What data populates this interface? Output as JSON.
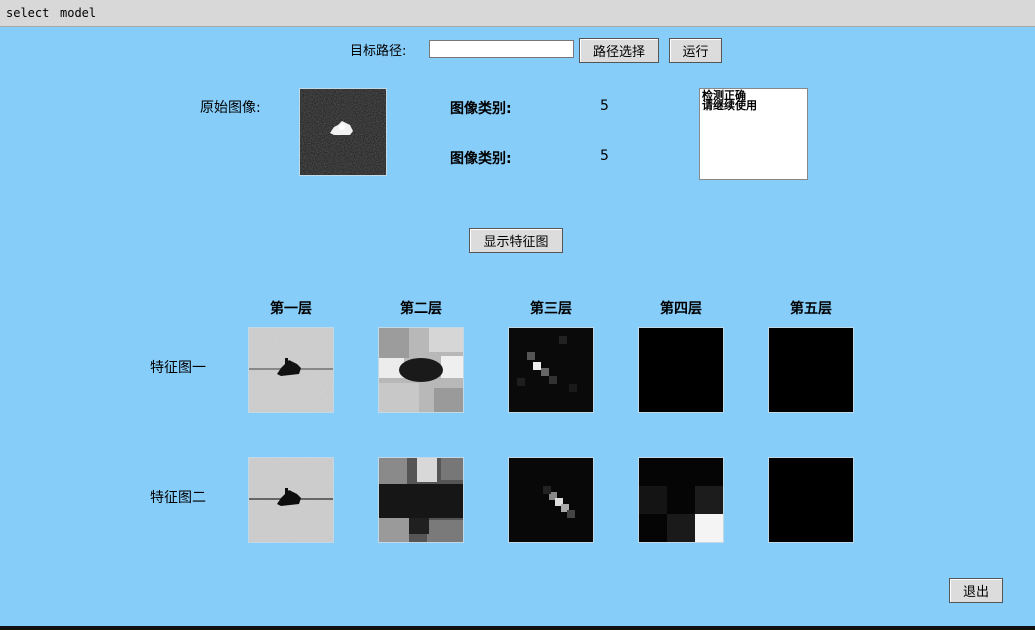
{
  "menu": {
    "items": [
      "select",
      "model"
    ]
  },
  "path": {
    "label": "目标路径:",
    "value": "",
    "browse_button": "路径选择",
    "run_button": "运行"
  },
  "original": {
    "label": "原始图像:"
  },
  "results": [
    {
      "label": "图像类别:",
      "value": "5"
    },
    {
      "label": "图像类别:",
      "value": "5"
    }
  ],
  "status_list": [
    "检测正确",
    "请继续使用"
  ],
  "feature_button": "显示特征图",
  "layers": [
    "第一层",
    "第二层",
    "第三层",
    "第四层",
    "第五层"
  ],
  "rows": [
    "特征图一",
    "特征图二"
  ],
  "exit_button": "退出"
}
